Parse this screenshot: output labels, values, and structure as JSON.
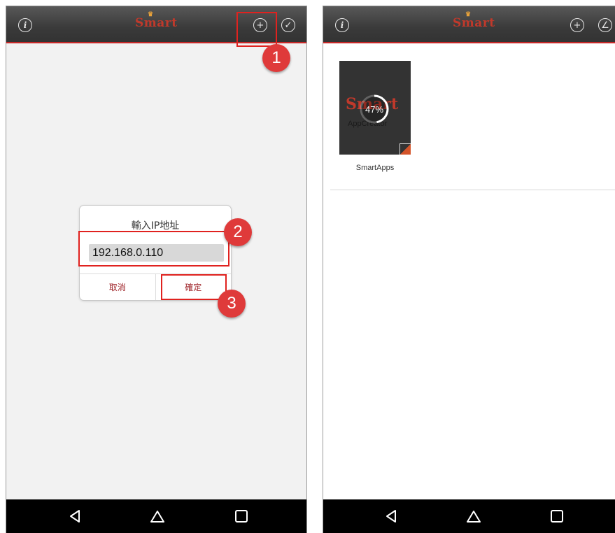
{
  "left_screen": {
    "logo": "Smart",
    "icons": {
      "info": "info-icon",
      "add": "add-circle-icon",
      "check": "check-circle-icon"
    },
    "dialog": {
      "title": "輸入IP地址",
      "input_value": "192.168.0.110",
      "cancel_label": "取消",
      "confirm_label": "確定"
    },
    "steps": [
      "1",
      "2",
      "3"
    ]
  },
  "right_screen": {
    "logo": "Smart",
    "icons": {
      "info": "info-icon",
      "add": "add-circle-icon",
      "edit": "edit-circle-icon"
    },
    "app": {
      "thumb_logo": "Smart",
      "thumb_subtitle": "AppCreator",
      "progress_label": "47%",
      "progress": 0.47,
      "label": "SmartApps"
    }
  },
  "navbar": {
    "icons": [
      "back-icon",
      "home-icon",
      "recent-apps-icon"
    ]
  },
  "colors": {
    "accent": "#c62828",
    "callout": "#df3a3a",
    "topbar": "#3a3a3a"
  }
}
